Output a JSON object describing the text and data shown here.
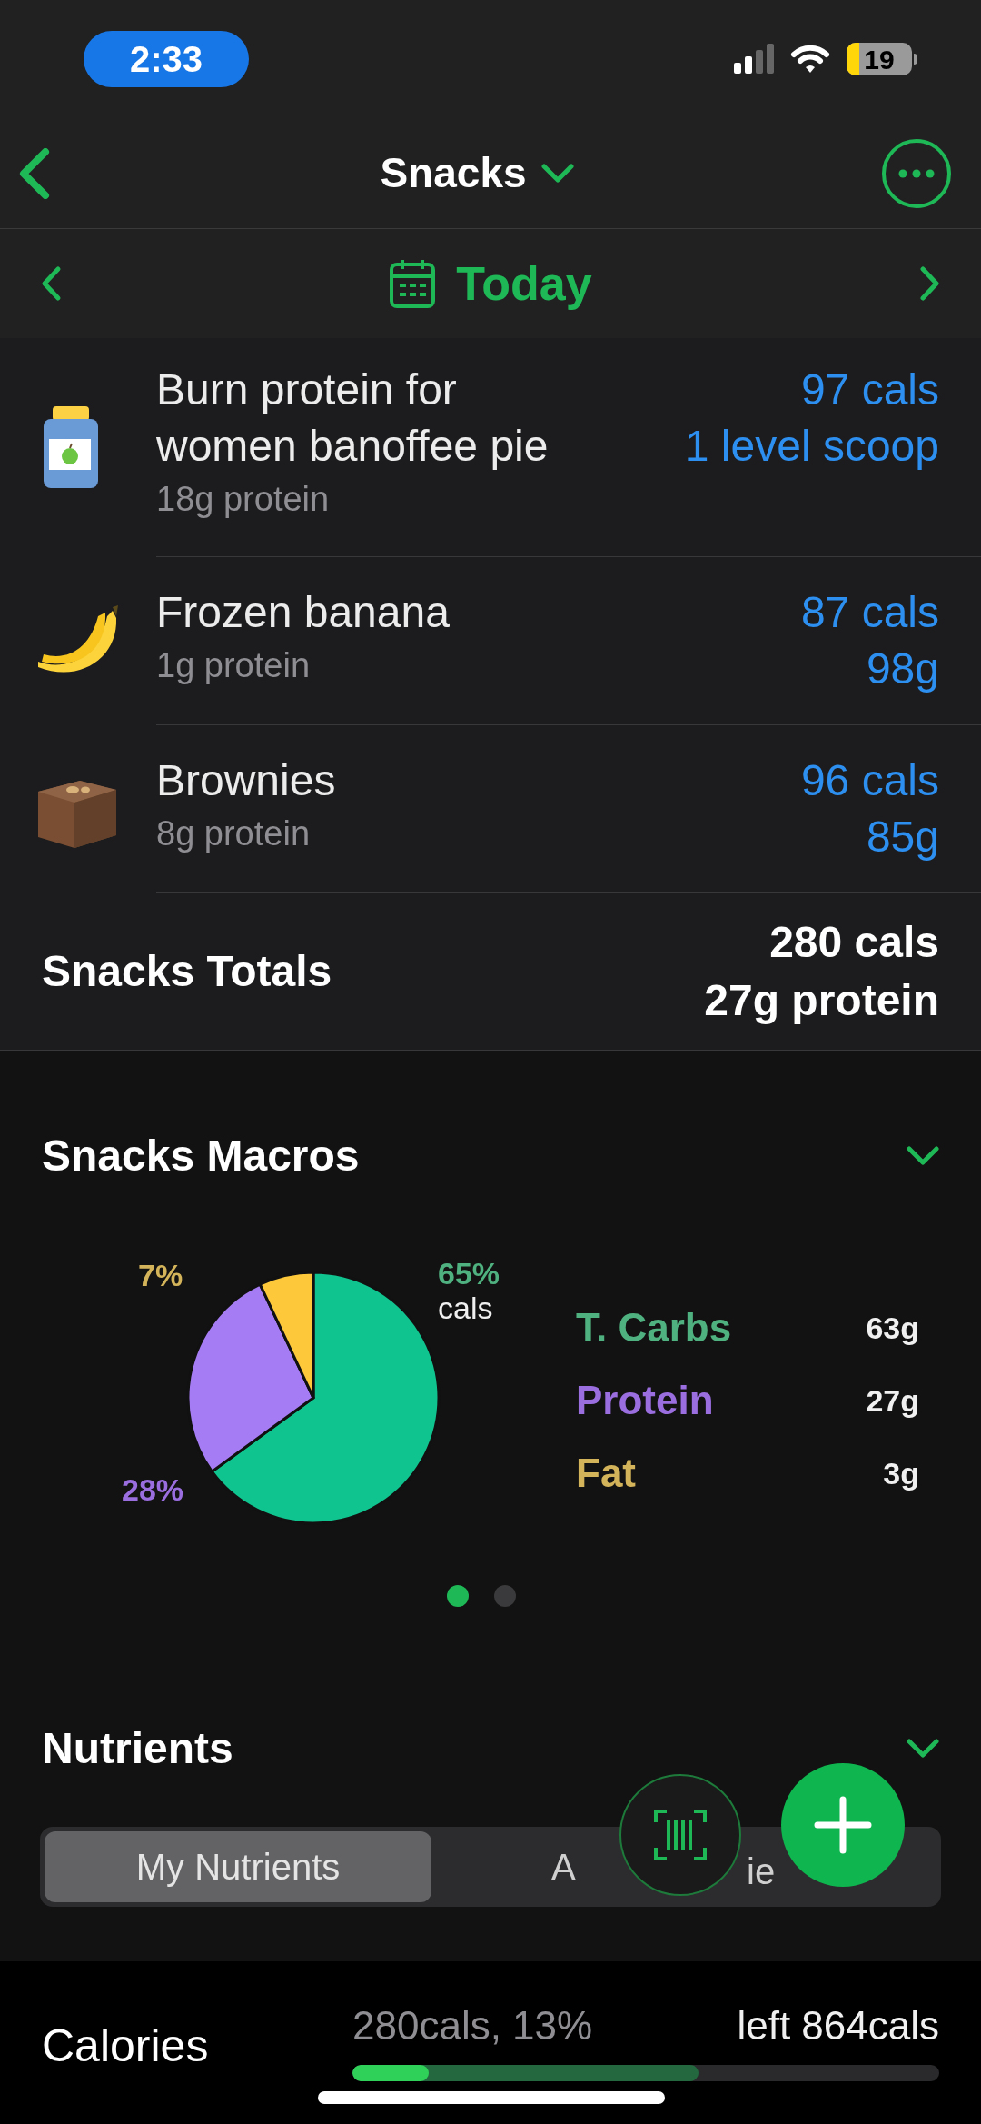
{
  "status_bar": {
    "time": "2:33",
    "battery": "19"
  },
  "nav": {
    "title": "Snacks"
  },
  "date_bar": {
    "label": "Today"
  },
  "entries": [
    {
      "kind": "jar",
      "name": "Burn protein for women banoffee pie",
      "protein": "18g protein",
      "cals": "97 cals",
      "amount": "1 level scoop"
    },
    {
      "kind": "banana",
      "name": "Frozen banana",
      "protein": "1g protein",
      "cals": "87 cals",
      "amount": "98g"
    },
    {
      "kind": "brownie",
      "name": "Brownies",
      "protein": "8g protein",
      "cals": "96 cals",
      "amount": "85g"
    }
  ],
  "totals": {
    "label": "Snacks Totals",
    "cals": "280 cals",
    "protein": "27g protein"
  },
  "macros": {
    "title": "Snacks Macros",
    "chart_data": {
      "type": "pie",
      "categories": [
        "T. Carbs",
        "Protein",
        "Fat"
      ],
      "series": [
        {
          "values": [
            65,
            28,
            7
          ]
        }
      ],
      "colors": [
        "#10c48f",
        "#a67cf5",
        "#fdc83a"
      ],
      "value_labels": [
        "65%",
        "28%",
        "7%"
      ],
      "annotations": [
        "cals"
      ]
    },
    "legend": [
      {
        "value": "63g",
        "color": "#4fb17f"
      },
      {
        "value": "27g",
        "color": "#9b6ee0"
      },
      {
        "value": "3g",
        "color": "#d4b45a"
      }
    ],
    "pages": [
      {
        "selected": true
      },
      {
        "selected": false
      }
    ]
  },
  "nutrients": {
    "title": "Nutrients",
    "tabs": [
      {
        "label": "My Nutrients",
        "selected": true
      },
      {
        "label": "A",
        "selected": false,
        "hidden_part": "ie"
      }
    ]
  },
  "calories": {
    "label": "Calories",
    "consumed": "280cals, 13%",
    "left": "left 864cals",
    "fills": [
      {
        "level": 0.59,
        "color": "#23683f"
      },
      {
        "level": 0.13,
        "color": "#30d158"
      }
    ]
  }
}
